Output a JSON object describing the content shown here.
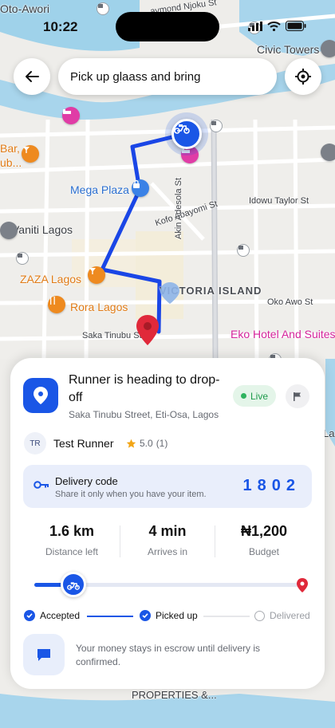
{
  "status_bar": {
    "time": "10:22"
  },
  "search": {
    "text": "Pick up glaass and bring"
  },
  "map": {
    "labels": {
      "oto_awori": "Oto-Awori",
      "raymond_njoku": "aymond Njoku St",
      "civic_towers": "Civic Towers",
      "bar": "Bar,",
      "bar2": "ub...",
      "mega_plaza": "Mega Plaza",
      "idowu_taylor": "Idowu Taylor St",
      "kofo_abayomi": "Kofo Abayomi St",
      "akin_adesola": "Akin Adesola St",
      "vaniti_lagos": "Vaniti Lagos",
      "zaza_lagos": "ZAZA Lagos",
      "victoria_island": "VICTORIA ISLAND",
      "rora_lagos": "Rora Lagos",
      "oko_awo": "Oko Awo St",
      "saka_tinubu": "Saka Tinubu St",
      "eko_hotel": "Eko Hotel And Suites",
      "properties": "PROPERTIES &...",
      "la": "La"
    }
  },
  "sheet": {
    "title": "Runner is heading to drop-off",
    "address": "Saka Tinubu Street, Eti-Osa, Lagos",
    "live_label": "Live",
    "runner": {
      "initials": "TR",
      "name": "Test Runner",
      "rating": "5.0",
      "reviews": "(1)"
    },
    "delivery_code": {
      "title": "Delivery code",
      "subtitle": "Share it only when you have your item.",
      "value": "1802"
    },
    "stats": [
      {
        "value": "1.6 km",
        "label": "Distance left"
      },
      {
        "value": "4 min",
        "label": "Arrives in"
      },
      {
        "value": "₦1,200",
        "label": "Budget"
      }
    ],
    "progress": 0.17,
    "steps": [
      {
        "label": "Accepted",
        "done": true
      },
      {
        "label": "Picked up",
        "done": true
      },
      {
        "label": "Delivered",
        "done": false
      }
    ],
    "escrow_note": "Your money stays in escrow until delivery is confirmed."
  },
  "colors": {
    "accent": "#1a56e6",
    "live": "#1f9b4c",
    "pin": "#e0293a"
  }
}
